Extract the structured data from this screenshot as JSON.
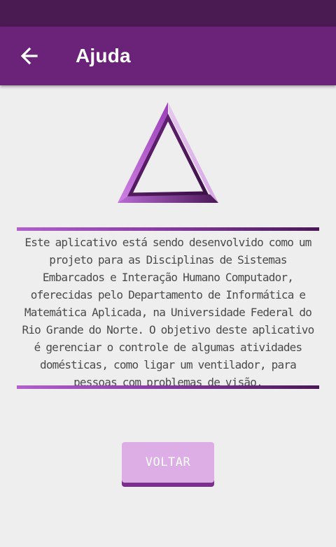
{
  "app_bar": {
    "title": "Ajuda",
    "back_icon": "arrow-left-icon"
  },
  "logo": {
    "icon": "triangle-logo-icon",
    "colors": {
      "light": "#cc80e0",
      "mid": "#9a3fb8",
      "dark": "#4a1856",
      "faint": "#e4c8ec"
    }
  },
  "about": {
    "text": "Este aplicativo está sendo desenvolvido como um projeto para as Disciplinas de Sistemas Embarcados e Interação Humano Computador, oferecidas pelo Departamento de Informática e Matemática Aplicada, na Universidade Federal do Rio Grande do Norte. O objetivo deste aplicativo é gerenciar o controle de algumas atividades domésticas, como ligar um ventilador, para pessoas com problemas de visão."
  },
  "actions": {
    "back_label": "VOLTAR"
  },
  "colors": {
    "status_bar": "#4a1a52",
    "app_bar": "#6a2379",
    "background": "#eeeeee",
    "button": "#dcaee5",
    "button_shadow": "#7a2f8c",
    "text": "#4a4a4a"
  }
}
